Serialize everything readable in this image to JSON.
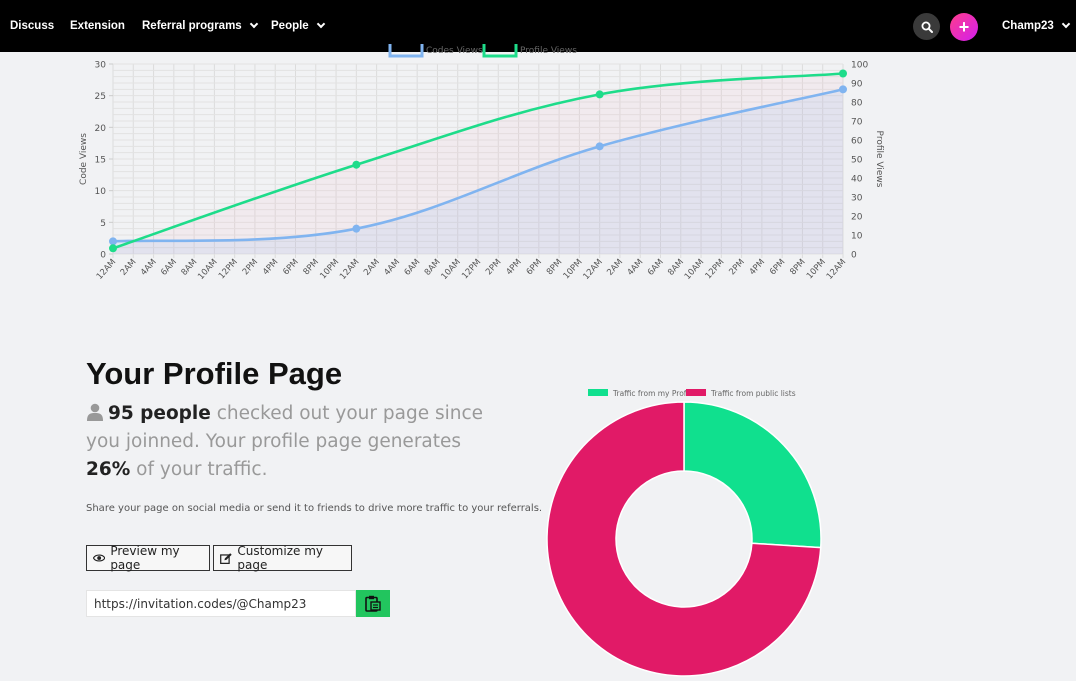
{
  "nav": {
    "discuss": "Discuss",
    "extension": "Extension",
    "referral": "Referral programs",
    "people": "People",
    "user": "Champ23"
  },
  "colors": {
    "code_views": "#80b4f0",
    "profile_views": "#1edc8a",
    "traffic_profile": "#10e08e",
    "traffic_public": "#e11a67",
    "copy_button": "#22c55e"
  },
  "chart_data": [
    {
      "type": "line",
      "legend": [
        "Codes Views",
        "Profile Views"
      ],
      "ylabel_left": "Code Views",
      "ylabel_right": "Profile Views",
      "ylim_left": [
        0,
        30
      ],
      "ylim_right": [
        0,
        100
      ],
      "yticks_left": [
        "0",
        "5",
        "10",
        "15",
        "20",
        "25",
        "30"
      ],
      "yticks_right": [
        "0",
        "10",
        "20",
        "30",
        "40",
        "50",
        "60",
        "70",
        "80",
        "90",
        "100"
      ],
      "x_labels": [
        "12AM",
        "2AM",
        "4AM",
        "6AM",
        "8AM",
        "10AM",
        "12PM",
        "2PM",
        "4PM",
        "6PM",
        "8PM",
        "10PM",
        "12AM",
        "2AM",
        "4AM",
        "6AM",
        "8AM",
        "10AM",
        "12PM",
        "2PM",
        "4PM",
        "6PM",
        "8PM",
        "10PM",
        "12AM",
        "2AM",
        "4AM",
        "6AM",
        "8AM",
        "10AM",
        "12PM",
        "2PM",
        "4PM",
        "6PM",
        "8PM",
        "10PM",
        "12AM"
      ],
      "series": [
        {
          "name": "Codes Views",
          "axis": "left",
          "x_index": [
            0,
            12,
            24,
            36
          ],
          "values": [
            2,
            4,
            17,
            26
          ]
        },
        {
          "name": "Profile Views",
          "axis": "right",
          "x_index": [
            0,
            12,
            24,
            36
          ],
          "values": [
            3,
            47,
            84,
            95
          ]
        }
      ],
      "grid": true,
      "legend_position": "top"
    },
    {
      "type": "pie",
      "legend": [
        "Traffic from my Profile",
        "Traffic from public lists"
      ],
      "values": [
        26,
        74
      ],
      "legend_position": "top"
    }
  ],
  "profile": {
    "title": "Your Profile Page",
    "people_count": "95 people",
    "text1": " checked out your page since you joinned. Your profile page generates ",
    "percent": "26%",
    "text2": " of your traffic.",
    "note": "Share your page on social media or send it to friends to drive more traffic to your referrals.",
    "preview_label": "Preview my page",
    "customize_label": "Customize my page",
    "url": "https://invitation.codes/@Champ23"
  }
}
